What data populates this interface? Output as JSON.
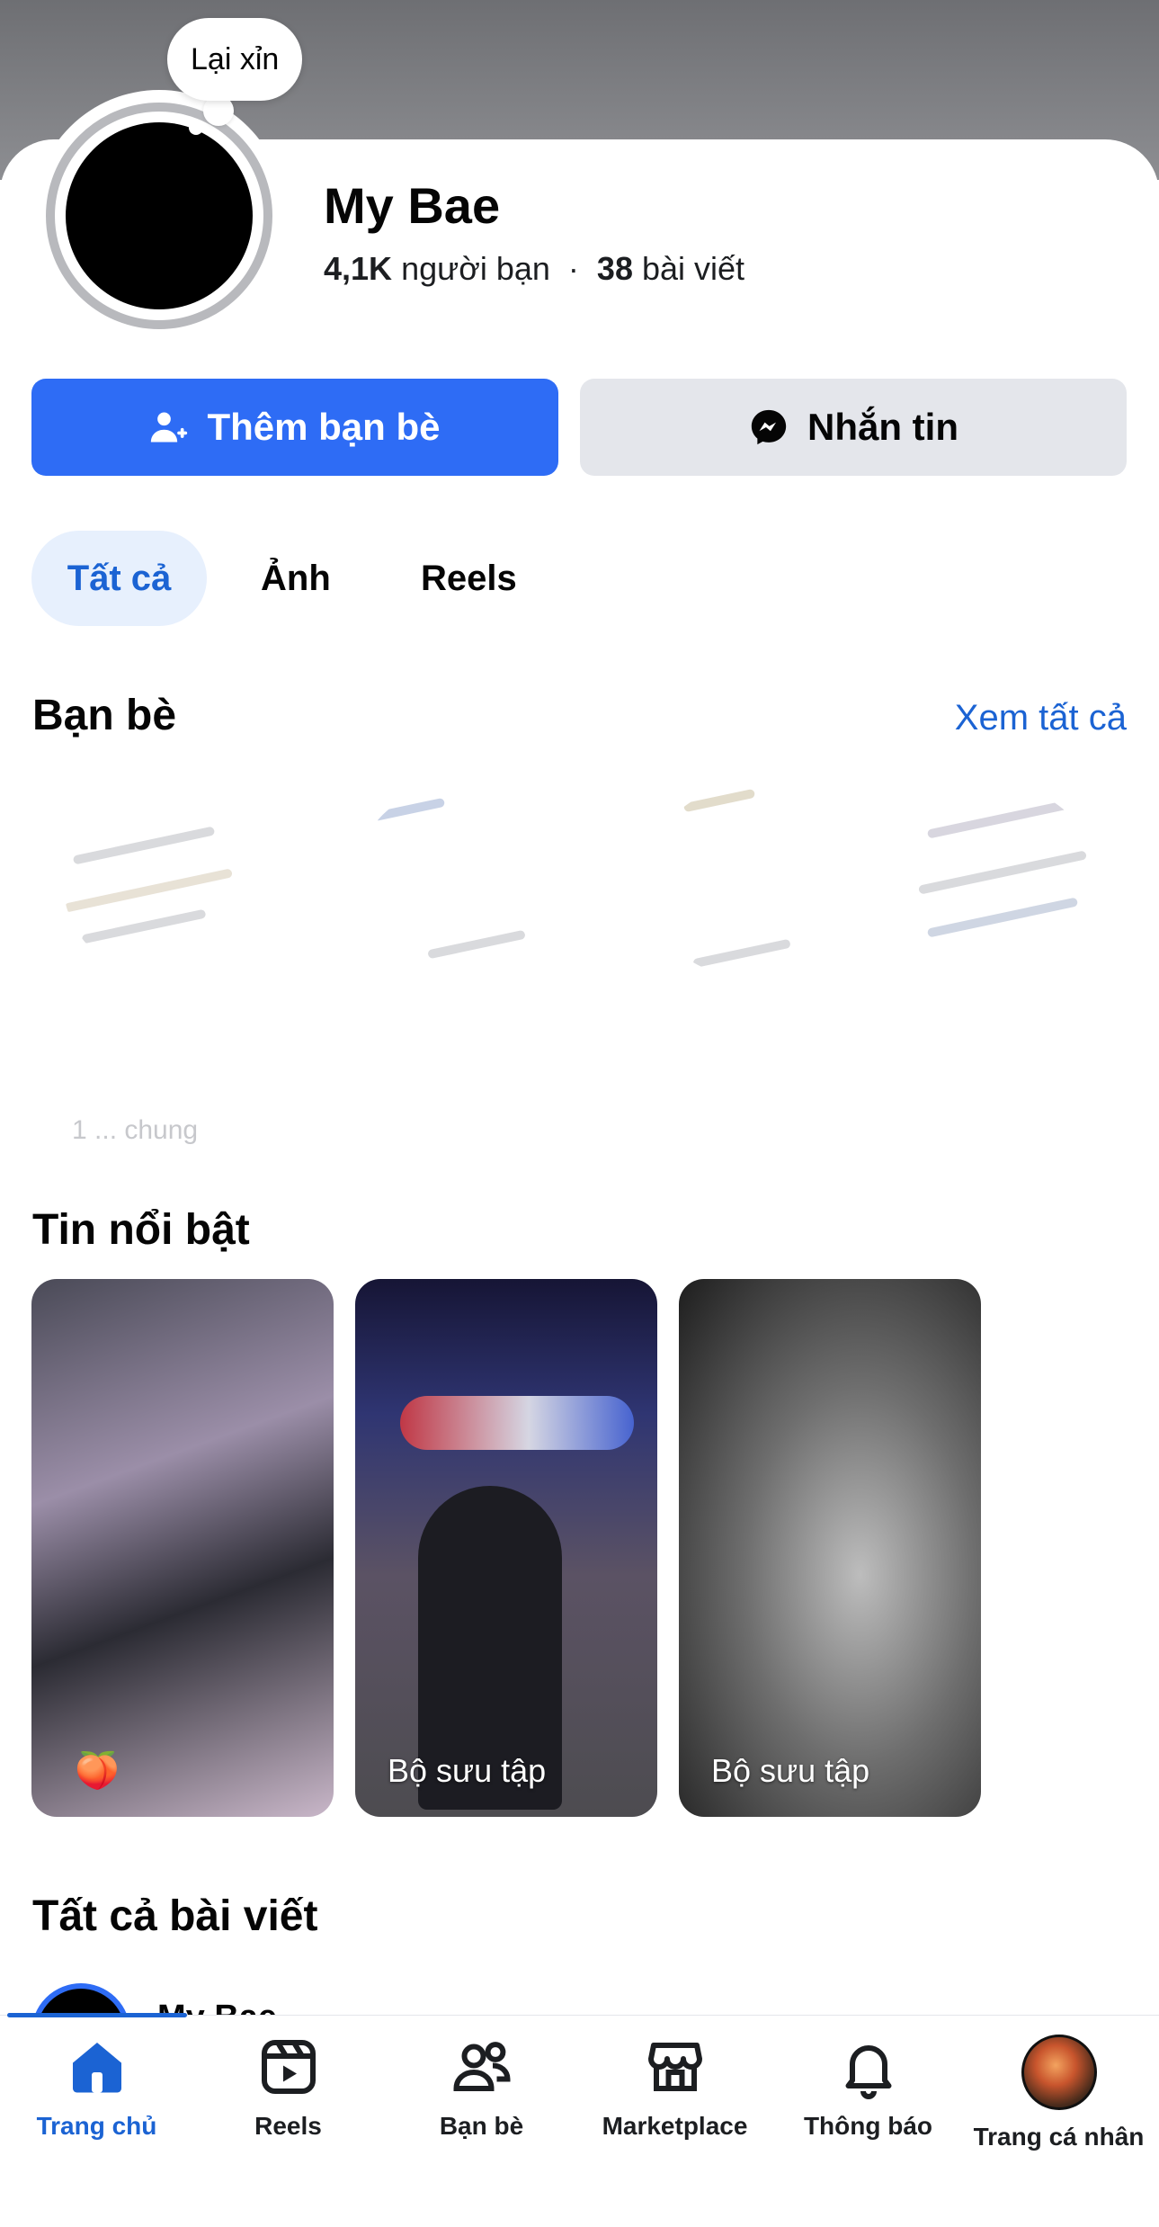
{
  "profile": {
    "note": "Lại xỉn",
    "name": "My Bae",
    "friends_count": "4,1K",
    "friends_label": "người bạn",
    "separator": "·",
    "posts_count": "38",
    "posts_label": "bài viết"
  },
  "actions": {
    "add_friend": "Thêm bạn bè",
    "message": "Nhắn tin"
  },
  "filters": [
    {
      "label": "Tất cả",
      "selected": true
    },
    {
      "label": "Ảnh",
      "selected": false
    },
    {
      "label": "Reels",
      "selected": false
    }
  ],
  "friends_section": {
    "title": "Bạn bè",
    "see_all": "Xem tất cả",
    "mutual_fragment": "1 ... chung"
  },
  "highlights_section": {
    "title": "Tin nổi bật",
    "items": [
      {
        "caption": "",
        "emoji": "🍑"
      },
      {
        "caption": "Bộ sưu tập"
      },
      {
        "caption": "Bộ sưu tập"
      }
    ]
  },
  "posts_section": {
    "title": "Tất cả bài viết",
    "first_post_author": "My Bae"
  },
  "bottom_nav": [
    {
      "label": "Trang chủ",
      "icon": "home-icon",
      "active": true
    },
    {
      "label": "Reels",
      "icon": "reels-icon"
    },
    {
      "label": "Bạn bè",
      "icon": "friends-icon"
    },
    {
      "label": "Marketplace",
      "icon": "marketplace-icon"
    },
    {
      "label": "Thông báo",
      "icon": "bell-icon"
    },
    {
      "label": "Trang cá nhân",
      "icon": "profile-avatar-icon"
    }
  ],
  "colors": {
    "accent": "#2e6cf5",
    "link": "#1b63d3",
    "secondary_button": "#e4e6eb"
  }
}
